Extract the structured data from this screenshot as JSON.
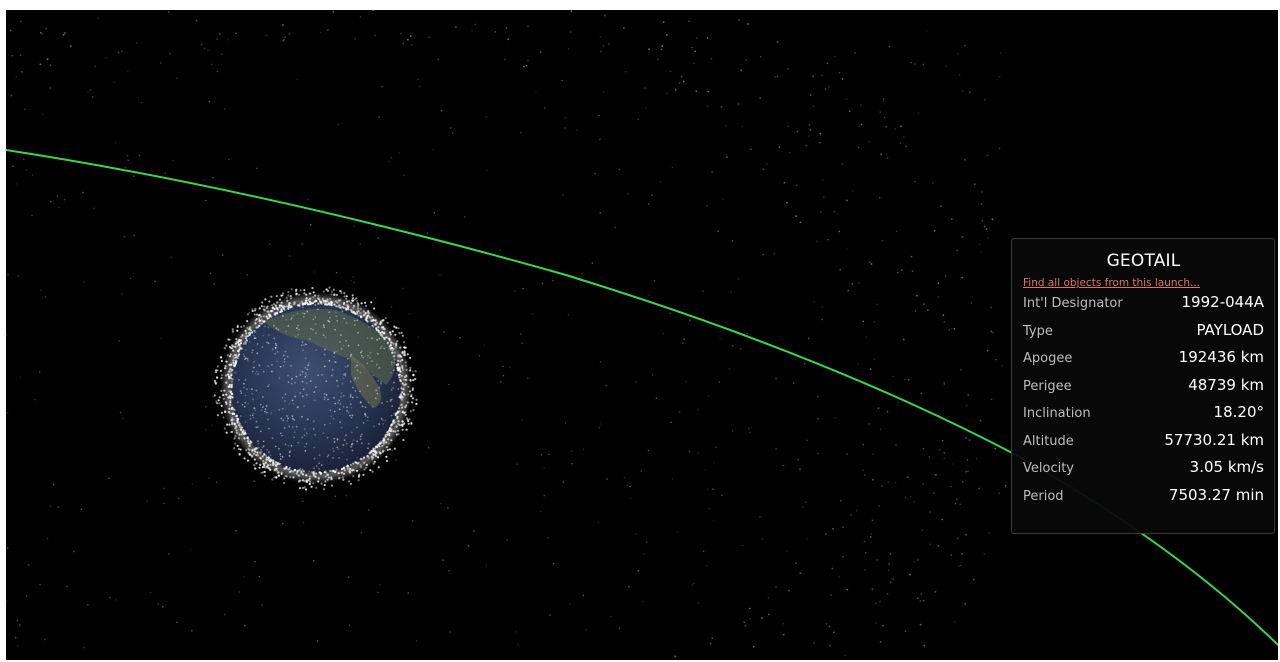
{
  "satellite": {
    "name": "GEOTAIL",
    "launch_link": "Find all objects from this launch..."
  },
  "details": [
    {
      "label": "Int'l Designator",
      "value": "1992-044A"
    },
    {
      "label": "Type",
      "value": "PAYLOAD"
    },
    {
      "label": "Apogee",
      "value": "192436 km"
    },
    {
      "label": "Perigee",
      "value": "48739 km"
    },
    {
      "label": "Inclination",
      "value": "18.20°"
    },
    {
      "label": "Altitude",
      "value": "57730.21 km"
    },
    {
      "label": "Velocity",
      "value": "3.05 km/s"
    },
    {
      "label": "Period",
      "value": "7503.27 min"
    }
  ],
  "colors": {
    "space_background": "#000000",
    "orbit_line": "#3bd64a",
    "link": "#d9736b",
    "debris": "#ffffff",
    "earth_ocean": "#2b3a5a"
  },
  "icons": {
    "earth": "earth-globe",
    "debris": "satellite-dot"
  }
}
